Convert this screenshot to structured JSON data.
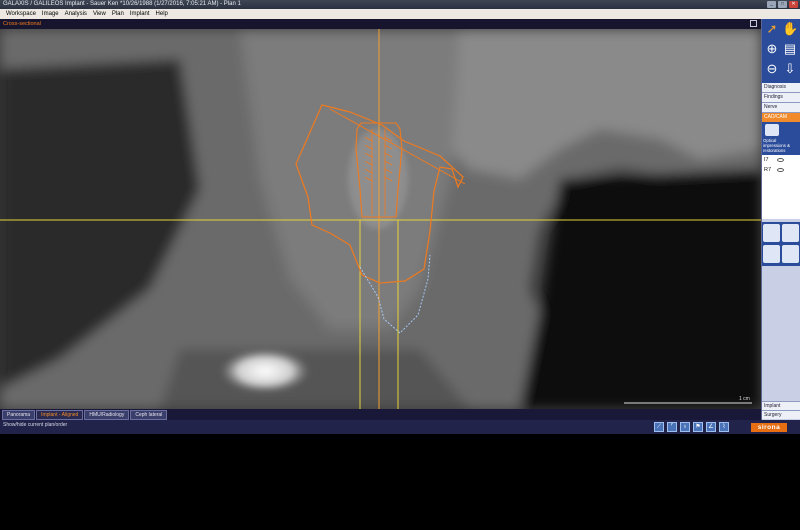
{
  "window": {
    "title": "GALAXIS / GALILEOS Implant - Sauer Ken *10/26/1988 (1/27/2016, 7:05:21 AM) - Plan 1",
    "buttons": [
      "_",
      "□",
      "✕"
    ]
  },
  "menu": [
    "Workspace",
    "Image",
    "Analysis",
    "View",
    "Plan",
    "Implant",
    "Help"
  ],
  "view": {
    "title": "Cross-sectional",
    "scale_label": "1 cm"
  },
  "tabs": [
    {
      "label": "Panorama",
      "active": false
    },
    {
      "label": "Implant - Aligned",
      "active": true
    },
    {
      "label": "HMU/Radiology",
      "active": false
    },
    {
      "label": "Ceph lateral",
      "active": false
    }
  ],
  "status": {
    "message": "Show/hide current plan/order",
    "brand": "sirona"
  },
  "right_panel": {
    "tabs": [
      {
        "label": "Diagnosis",
        "active": false
      },
      {
        "label": "Findings",
        "active": false
      },
      {
        "label": "Nerve",
        "active": false
      },
      {
        "label": "CAD/CAM",
        "active": true
      }
    ],
    "optical_label": "Optical impressions & restorations",
    "items": [
      "I7",
      "R7"
    ],
    "bottom_tabs": [
      "Implant",
      "Surgery"
    ]
  },
  "colors": {
    "accent": "#f08a2a",
    "crosshair": "#e8d23a",
    "implant_outline": "#f07a1e",
    "nerve_outline": "#a6c8f0",
    "panel_blue": "#2b4c9a"
  }
}
